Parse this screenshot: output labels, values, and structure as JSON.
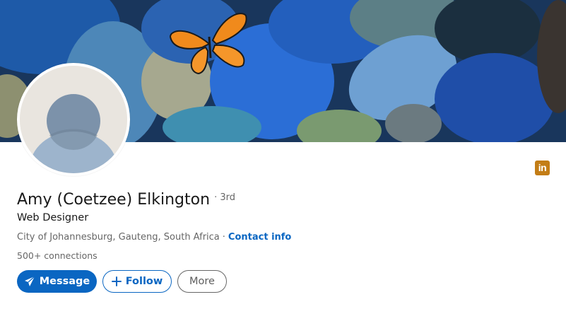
{
  "profile": {
    "name": "Amy (Coetzee) Elkington",
    "degree": "· 3rd",
    "headline": "Web Designer",
    "location": "City of Johannesburg, Gauteng, South Africa",
    "location_separator": "·",
    "contact_label": "Contact info",
    "connections": "500+ connections"
  },
  "actions": {
    "message_label": "Message",
    "follow_label": "Follow",
    "more_label": "More"
  },
  "badge": {
    "text": "in",
    "color": "#c37d16"
  },
  "icons": {
    "message": "paper-plane-icon",
    "follow": "plus-icon",
    "badge": "linkedin-icon",
    "banner_decoration": "butterfly-icon"
  },
  "colors": {
    "primary": "#0a66c2",
    "text": "#191919",
    "muted": "#666666"
  }
}
